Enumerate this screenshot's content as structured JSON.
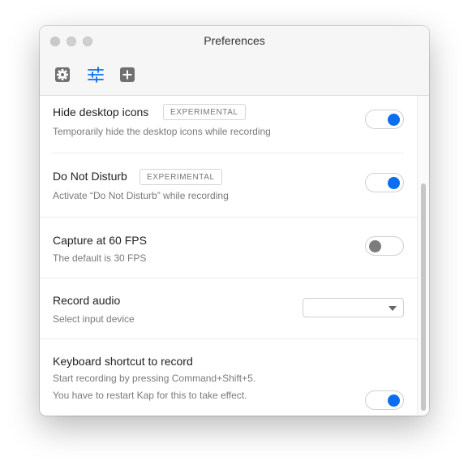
{
  "window": {
    "title": "Preferences"
  },
  "toolbar": {
    "tabs": [
      {
        "icon": "gear-icon",
        "active": false
      },
      {
        "icon": "sliders-icon",
        "active": true
      },
      {
        "icon": "plus-square-icon",
        "active": false
      }
    ]
  },
  "settings": [
    {
      "label": "Hide desktop icons",
      "badge": "EXPERIMENTAL",
      "desc": "Temporarily hide the desktop icons while recording",
      "control": "toggle",
      "state": "on"
    },
    {
      "label": "Do Not Disturb",
      "badge": "EXPERIMENTAL",
      "desc": "Activate “Do Not Disturb” while recording",
      "control": "toggle",
      "state": "on"
    },
    {
      "label": "Capture at 60 FPS",
      "desc": "The default is 30 FPS",
      "control": "toggle",
      "state": "off"
    },
    {
      "label": "Record audio",
      "desc": "Select input device",
      "control": "select",
      "value": ""
    },
    {
      "label": "Keyboard shortcut to record",
      "desc": "Start recording by pressing Command+Shift+5.",
      "desc2": "You have to restart Kap for this to take effect.",
      "control": "toggle",
      "state": "on"
    }
  ],
  "colors": {
    "accent": "#0a6ef0",
    "toggle_off_knob": "#7c7c7c"
  }
}
